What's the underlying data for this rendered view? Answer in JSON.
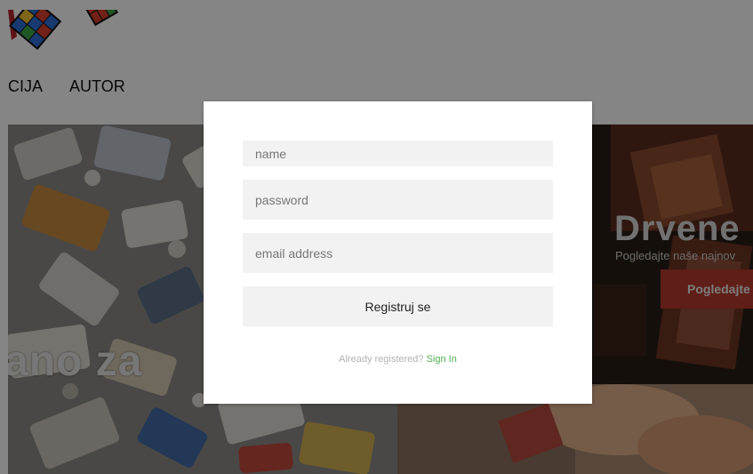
{
  "nav": {
    "items": [
      "CIJA",
      "AUTOR"
    ]
  },
  "hero": {
    "headline": "ano za",
    "promo_title": "Drvene p",
    "promo_subtitle": "Pogledajte naše najnov",
    "promo_button": "Pogledajte"
  },
  "form": {
    "name_placeholder": "name",
    "password_placeholder": "password",
    "email_placeholder": "email address",
    "submit_label": "Registruj se",
    "already_registered": "Already registered?",
    "sign_in_label": "Sign In"
  },
  "colors": {
    "link": "#4caf50",
    "field_bg": "#f2f2f2",
    "promo_button_bg": "#b63a2c"
  }
}
